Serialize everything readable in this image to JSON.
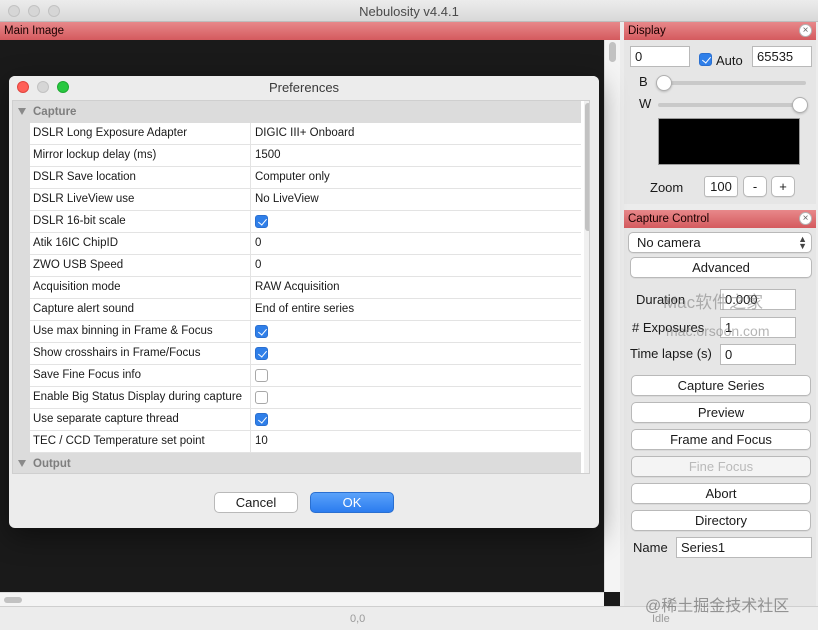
{
  "app": {
    "title": "Nebulosity v4.4.1"
  },
  "main_panel": {
    "header": "Main Image"
  },
  "status": {
    "coord": "0,0",
    "state": "Idle"
  },
  "display": {
    "header": "Display",
    "black_value": "0",
    "auto_label": "Auto",
    "auto_checked": true,
    "white_value": "65535",
    "b_label": "B",
    "w_label": "W",
    "b_slider_fraction": 0.0,
    "w_slider_fraction": 1.0,
    "zoom_label": "Zoom",
    "zoom_value": "100",
    "zoom_minus": "-",
    "zoom_plus": "+"
  },
  "capture_control": {
    "header": "Capture Control",
    "camera_select": "No camera",
    "advanced": "Advanced",
    "duration_label": "Duration",
    "duration_value": "0.000",
    "exposures_label": "# Exposures",
    "exposures_value": "1",
    "timelapse_label": "Time lapse (s)",
    "timelapse_value": "0",
    "capture_series": "Capture Series",
    "preview": "Preview",
    "frame_focus": "Frame and Focus",
    "fine_focus": "Fine Focus",
    "abort": "Abort",
    "directory": "Directory",
    "name_label": "Name",
    "name_value": "Series1"
  },
  "watermarks": {
    "site_cn": "Mac软件之家",
    "site": "mac.orsoon.com",
    "juejin": "@稀土掘金技术社区"
  },
  "preferences": {
    "title": "Preferences",
    "categories": {
      "capture": "Capture",
      "output": "Output"
    },
    "rows": [
      {
        "name": "DSLR Long Exposure Adapter",
        "value": "DIGIC III+ Onboard"
      },
      {
        "name": "Mirror lockup delay (ms)",
        "value": "1500"
      },
      {
        "name": "DSLR Save location",
        "value": "Computer only"
      },
      {
        "name": "DSLR LiveView use",
        "value": "No LiveView"
      },
      {
        "name": "DSLR 16-bit scale",
        "checked": true
      },
      {
        "name": "Atik 16IC ChipID",
        "value": "0"
      },
      {
        "name": "ZWO USB Speed",
        "value": "0"
      },
      {
        "name": "Acquisition mode",
        "value": "RAW Acquisition"
      },
      {
        "name": "Capture alert sound",
        "value": "End of entire series"
      },
      {
        "name": "Use max binning in Frame & Focus",
        "checked": true
      },
      {
        "name": "Show crosshairs in Frame/Focus",
        "checked": true
      },
      {
        "name": "Save Fine Focus info",
        "checked": false
      },
      {
        "name": "Enable Big Status Display during capture",
        "checked": false
      },
      {
        "name": "Use separate capture thread",
        "checked": true
      },
      {
        "name": "TEC / CCD Temperature set point",
        "value": "10"
      }
    ],
    "cancel": "Cancel",
    "ok": "OK"
  }
}
